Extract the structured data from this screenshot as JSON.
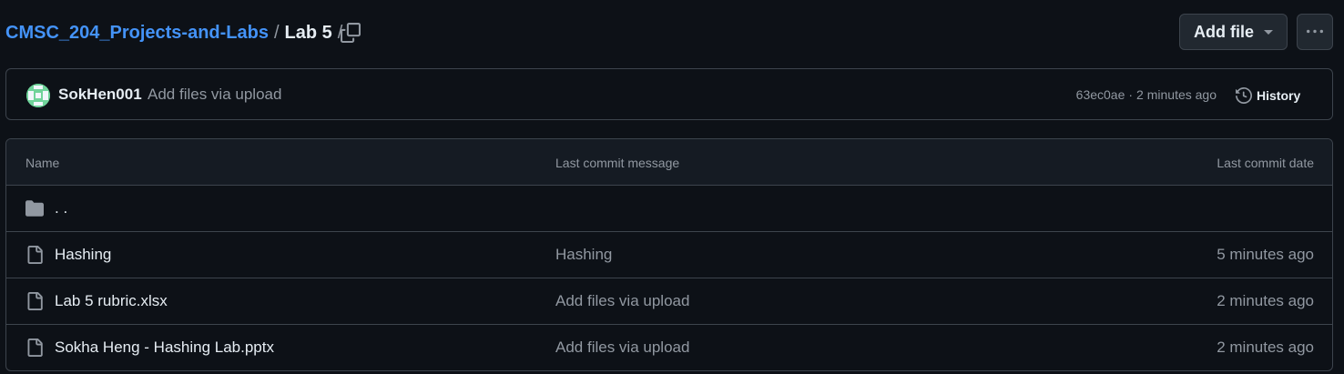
{
  "breadcrumb": {
    "repo": "CMSC_204_Projects-and-Labs",
    "separator": "/",
    "current": "Lab 5",
    "trailing": "/"
  },
  "toolbar": {
    "add_file_label": "Add file",
    "more_icon": "kebab-horizontal-icon",
    "copy_icon": "copy-icon"
  },
  "commit": {
    "author": "SokHen001",
    "message": "Add files via upload",
    "hash": "63ec0ae",
    "separator": "·",
    "time": "2 minutes ago",
    "history_label": "History",
    "history_icon": "history-icon"
  },
  "table": {
    "headers": {
      "name": "Name",
      "message": "Last commit message",
      "date": "Last commit date"
    },
    "parent_label": ". .",
    "rows": [
      {
        "name": "Hashing",
        "message": "Hashing",
        "date": "5 minutes ago",
        "icon": "file-icon"
      },
      {
        "name": "Lab 5 rubric.xlsx",
        "message": "Add files via upload",
        "date": "2 minutes ago",
        "icon": "file-icon"
      },
      {
        "name": "Sokha Heng - Hashing Lab.pptx",
        "message": "Add files via upload",
        "date": "2 minutes ago",
        "icon": "file-icon"
      }
    ]
  },
  "colors": {
    "background": "#0d1117",
    "link": "#4493f8",
    "border": "#3d444d",
    "muted_text": "#9198a1"
  }
}
